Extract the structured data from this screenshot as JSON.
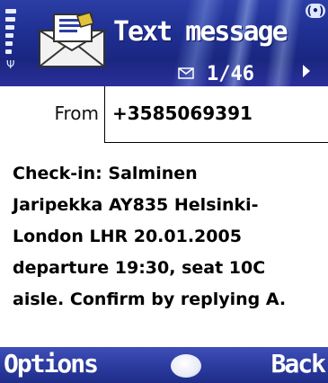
{
  "titlebar": {
    "title": "Text message",
    "message_counter": "1/46",
    "radio_indicator": "(•)"
  },
  "from": {
    "label": "From",
    "value": "+3585069391"
  },
  "message": {
    "lines": [
      "Check-in: Salminen",
      "Jaripekka AY835 Helsinki-",
      "London LHR 20.01.2005",
      "departure 19:30, seat 10C",
      "aisle. Confirm by replying A."
    ]
  },
  "softkeys": {
    "left_label": "Options",
    "right_label": "Back"
  },
  "icons": {
    "signal": "signal-strength-icon",
    "app": "message-envelope-icon",
    "inbox": "inbox-envelope-icon",
    "next": "next-arrow-icon"
  },
  "colors": {
    "accent": "#2b3ea5",
    "background": "#ffffff",
    "text": "#000000"
  }
}
